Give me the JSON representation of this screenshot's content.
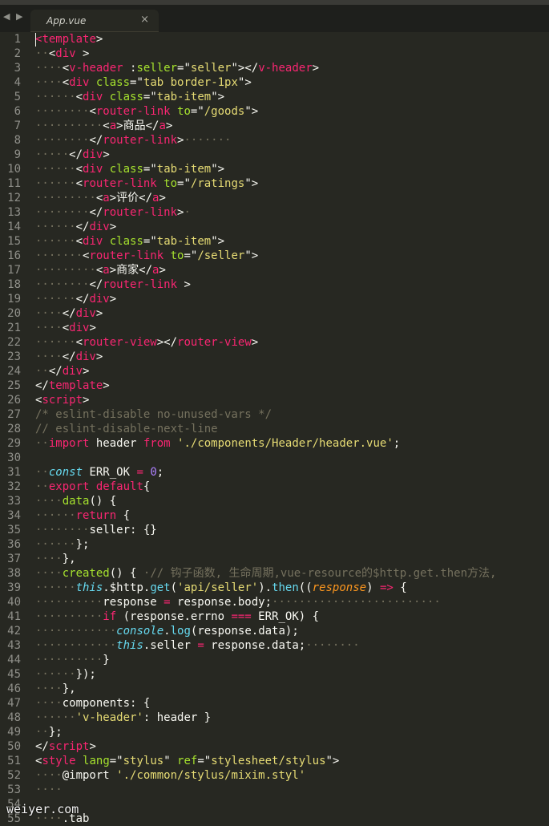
{
  "tab": {
    "title": "App.vue",
    "close": "×",
    "nav": "◀ ▶"
  },
  "watermark": "weiyer.com",
  "lines": [
    [
      [
        "t",
        "<"
      ],
      [
        "t",
        "template"
      ],
      [
        "",
        "&gt;"
      ]
    ],
    [
      [
        "c",
        "··"
      ],
      [
        "",
        "&lt;"
      ],
      [
        "t",
        "div"
      ],
      [
        "",
        " &gt;"
      ]
    ],
    [
      [
        "c",
        "····"
      ],
      [
        "",
        "&lt;"
      ],
      [
        "t",
        "v-header"
      ],
      [
        "",
        " :"
      ],
      [
        "a",
        "seller"
      ],
      [
        "",
        "=\""
      ],
      [
        "s",
        "seller"
      ],
      [
        "",
        "\"&gt;&lt;/"
      ],
      [
        "t",
        "v-header"
      ],
      [
        "",
        "&gt;"
      ]
    ],
    [
      [
        "c",
        "····"
      ],
      [
        "",
        "&lt;"
      ],
      [
        "t",
        "div"
      ],
      [
        "",
        " "
      ],
      [
        "a",
        "class"
      ],
      [
        "",
        "=\""
      ],
      [
        "s",
        "tab border-1px"
      ],
      [
        "",
        "\"&gt;"
      ]
    ],
    [
      [
        "c",
        "······"
      ],
      [
        "",
        "&lt;"
      ],
      [
        "t",
        "div"
      ],
      [
        "",
        " "
      ],
      [
        "a",
        "class"
      ],
      [
        "",
        "=\""
      ],
      [
        "s",
        "tab-item"
      ],
      [
        "",
        "\"&gt;"
      ]
    ],
    [
      [
        "c",
        "········"
      ],
      [
        "",
        "&lt;"
      ],
      [
        "t",
        "router-link"
      ],
      [
        "",
        " "
      ],
      [
        "a",
        "to"
      ],
      [
        "",
        "=\""
      ],
      [
        "s",
        "/goods"
      ],
      [
        "",
        "\"&gt;"
      ]
    ],
    [
      [
        "c",
        "··········"
      ],
      [
        "",
        "&lt;"
      ],
      [
        "t",
        "a"
      ],
      [
        "",
        "&gt;商品&lt;/"
      ],
      [
        "t",
        "a"
      ],
      [
        "",
        "&gt;"
      ]
    ],
    [
      [
        "c",
        "········"
      ],
      [
        "",
        "&lt;/"
      ],
      [
        "t",
        "router-link"
      ],
      [
        "",
        "&gt;"
      ],
      [
        "c",
        "·······"
      ]
    ],
    [
      [
        "c",
        "·····"
      ],
      [
        "",
        "&lt;/"
      ],
      [
        "t",
        "div"
      ],
      [
        "",
        "&gt;"
      ]
    ],
    [
      [
        "c",
        "······"
      ],
      [
        "",
        "&lt;"
      ],
      [
        "t",
        "div"
      ],
      [
        "",
        " "
      ],
      [
        "a",
        "class"
      ],
      [
        "",
        "=\""
      ],
      [
        "s",
        "tab-item"
      ],
      [
        "",
        "\"&gt;"
      ]
    ],
    [
      [
        "c",
        "······"
      ],
      [
        "",
        "&lt;"
      ],
      [
        "t",
        "router-link"
      ],
      [
        "",
        " "
      ],
      [
        "a",
        "to"
      ],
      [
        "",
        "=\""
      ],
      [
        "s",
        "/ratings"
      ],
      [
        "",
        "\"&gt;"
      ]
    ],
    [
      [
        "c",
        "·········"
      ],
      [
        "",
        "&lt;"
      ],
      [
        "t",
        "a"
      ],
      [
        "",
        "&gt;评价&lt;/"
      ],
      [
        "t",
        "a"
      ],
      [
        "",
        "&gt;"
      ]
    ],
    [
      [
        "c",
        "········"
      ],
      [
        "",
        "&lt;/"
      ],
      [
        "t",
        "router-link"
      ],
      [
        "",
        "&gt;"
      ],
      [
        "c",
        "·"
      ]
    ],
    [
      [
        "c",
        "······"
      ],
      [
        "",
        "&lt;/"
      ],
      [
        "t",
        "div"
      ],
      [
        "",
        "&gt;"
      ]
    ],
    [
      [
        "c",
        "······"
      ],
      [
        "",
        "&lt;"
      ],
      [
        "t",
        "div"
      ],
      [
        "",
        " "
      ],
      [
        "a",
        "class"
      ],
      [
        "",
        "=\""
      ],
      [
        "s",
        "tab-item"
      ],
      [
        "",
        "\"&gt;"
      ]
    ],
    [
      [
        "c",
        "·······"
      ],
      [
        "",
        "&lt;"
      ],
      [
        "t",
        "router-link"
      ],
      [
        "",
        " "
      ],
      [
        "a",
        "to"
      ],
      [
        "",
        "=\""
      ],
      [
        "s",
        "/seller"
      ],
      [
        "",
        "\"&gt;"
      ]
    ],
    [
      [
        "c",
        "·········"
      ],
      [
        "",
        "&lt;"
      ],
      [
        "t",
        "a"
      ],
      [
        "",
        "&gt;商家&lt;/"
      ],
      [
        "t",
        "a"
      ],
      [
        "",
        "&gt;"
      ]
    ],
    [
      [
        "c",
        "········"
      ],
      [
        "",
        "&lt;/"
      ],
      [
        "t",
        "router-link"
      ],
      [
        "",
        " &gt;"
      ]
    ],
    [
      [
        "c",
        "······"
      ],
      [
        "",
        "&lt;/"
      ],
      [
        "t",
        "div"
      ],
      [
        "",
        "&gt;"
      ]
    ],
    [
      [
        "c",
        "····"
      ],
      [
        "",
        "&lt;/"
      ],
      [
        "t",
        "div"
      ],
      [
        "",
        "&gt;"
      ]
    ],
    [
      [
        "c",
        "····"
      ],
      [
        "",
        "&lt;"
      ],
      [
        "t",
        "div"
      ],
      [
        "",
        "&gt;"
      ]
    ],
    [
      [
        "c",
        "······"
      ],
      [
        "",
        "&lt;"
      ],
      [
        "t",
        "router-view"
      ],
      [
        "",
        "&gt;&lt;/"
      ],
      [
        "t",
        "router-view"
      ],
      [
        "",
        "&gt;"
      ]
    ],
    [
      [
        "c",
        "····"
      ],
      [
        "",
        "&lt;/"
      ],
      [
        "t",
        "div"
      ],
      [
        "",
        "&gt;"
      ]
    ],
    [
      [
        "c",
        "··"
      ],
      [
        "",
        "&lt;/"
      ],
      [
        "t",
        "div"
      ],
      [
        "",
        "&gt;"
      ]
    ],
    [
      [
        "",
        "&lt;/"
      ],
      [
        "t",
        "template"
      ],
      [
        "",
        "&gt;"
      ]
    ],
    [
      [
        "",
        "&lt;"
      ],
      [
        "t",
        "script"
      ],
      [
        "",
        "&gt;"
      ]
    ],
    [
      [
        "c",
        "/* eslint-disable no-unused-vars */"
      ]
    ],
    [
      [
        "c",
        "// eslint-disable-next-line"
      ]
    ],
    [
      [
        "c",
        "··"
      ],
      [
        "k",
        "import"
      ],
      [
        "",
        " header "
      ],
      [
        "k",
        "from"
      ],
      [
        "",
        " "
      ],
      [
        "s",
        "'./components/Header/header.vue'"
      ],
      [
        "",
        ";"
      ]
    ],
    [
      [
        "",
        ""
      ]
    ],
    [
      [
        "c",
        "··"
      ],
      [
        "st",
        "const"
      ],
      [
        "",
        " ERR_OK "
      ],
      [
        "k",
        "="
      ],
      [
        "",
        " "
      ],
      [
        "n",
        "0"
      ],
      [
        "",
        ";"
      ]
    ],
    [
      [
        "c",
        "··"
      ],
      [
        "k",
        "export"
      ],
      [
        "",
        " "
      ],
      [
        "k",
        "default"
      ],
      [
        "",
        "{"
      ]
    ],
    [
      [
        "c",
        "····"
      ],
      [
        "a",
        "data"
      ],
      [
        "",
        "() {"
      ]
    ],
    [
      [
        "c",
        "······"
      ],
      [
        "k",
        "return"
      ],
      [
        "",
        " {"
      ]
    ],
    [
      [
        "c",
        "········"
      ],
      [
        "",
        "seller: {}"
      ]
    ],
    [
      [
        "c",
        "······"
      ],
      [
        "",
        "};"
      ]
    ],
    [
      [
        "c",
        "····"
      ],
      [
        "",
        "},"
      ]
    ],
    [
      [
        "c",
        "····"
      ],
      [
        "a",
        "created"
      ],
      [
        "",
        "() { "
      ],
      [
        "c",
        "·// 钩子函数, 生命周期,vue-resource的$http.get.then方法,"
      ]
    ],
    [
      [
        "c",
        "······"
      ],
      [
        "st",
        "this"
      ],
      [
        "",
        ".$http."
      ],
      [
        "f",
        "get"
      ],
      [
        "",
        "("
      ],
      [
        "s",
        "'api/seller'"
      ],
      [
        "",
        ")."
      ],
      [
        "f",
        "then"
      ],
      [
        "",
        "(("
      ],
      [
        "p",
        "response"
      ],
      [
        "",
        ") "
      ],
      [
        "k",
        "=&gt;"
      ],
      [
        "",
        " {"
      ]
    ],
    [
      [
        "c",
        "··········"
      ],
      [
        "",
        "response "
      ],
      [
        "k",
        "="
      ],
      [
        "",
        " response.body;"
      ],
      [
        "c",
        "·························"
      ]
    ],
    [
      [
        "c",
        "··········"
      ],
      [
        "k",
        "if"
      ],
      [
        "",
        " (response.errno "
      ],
      [
        "k",
        "==="
      ],
      [
        "",
        " ERR_OK) {"
      ]
    ],
    [
      [
        "c",
        "············"
      ],
      [
        "st",
        "console"
      ],
      [
        "",
        "."
      ],
      [
        "f",
        "log"
      ],
      [
        "",
        "(response.data);"
      ]
    ],
    [
      [
        "c",
        "············"
      ],
      [
        "st",
        "this"
      ],
      [
        "",
        ".seller "
      ],
      [
        "k",
        "="
      ],
      [
        "",
        " response.data;"
      ],
      [
        "c",
        "········"
      ]
    ],
    [
      [
        "c",
        "··········"
      ],
      [
        "",
        "}"
      ]
    ],
    [
      [
        "c",
        "······"
      ],
      [
        "",
        "});"
      ]
    ],
    [
      [
        "c",
        "····"
      ],
      [
        "",
        "},"
      ]
    ],
    [
      [
        "c",
        "····"
      ],
      [
        "",
        "components: {"
      ]
    ],
    [
      [
        "c",
        "······"
      ],
      [
        "s",
        "'v-header'"
      ],
      [
        "",
        ": header }"
      ]
    ],
    [
      [
        "c",
        "··"
      ],
      [
        "",
        "};"
      ]
    ],
    [
      [
        "",
        "&lt;/"
      ],
      [
        "t",
        "script"
      ],
      [
        "",
        "&gt;"
      ]
    ],
    [
      [
        "",
        "&lt;"
      ],
      [
        "t",
        "style"
      ],
      [
        "",
        " "
      ],
      [
        "a",
        "lang"
      ],
      [
        "",
        "=\""
      ],
      [
        "s",
        "stylus"
      ],
      [
        "",
        "\" "
      ],
      [
        "a",
        "ref"
      ],
      [
        "",
        "=\""
      ],
      [
        "s",
        "stylesheet/stylus"
      ],
      [
        "",
        "\"&gt;"
      ]
    ],
    [
      [
        "c",
        "····"
      ],
      [
        "",
        "@import "
      ],
      [
        "s",
        "'./common/stylus/mixim.styl'"
      ]
    ],
    [
      [
        "c",
        "····"
      ]
    ],
    [
      [
        "",
        ""
      ]
    ],
    [
      [
        "c",
        "····"
      ],
      [
        "",
        ".tab"
      ]
    ]
  ]
}
